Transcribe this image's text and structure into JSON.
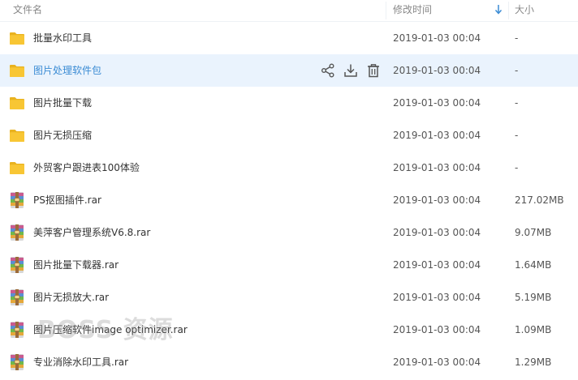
{
  "header": {
    "name": "文件名",
    "time": "修改时间",
    "size": "大小"
  },
  "files": [
    {
      "type": "folder",
      "name": "批量水印工具",
      "time": "2019-01-03 00:04",
      "size": "-"
    },
    {
      "type": "folder",
      "name": "图片处理软件包",
      "time": "2019-01-03 00:04",
      "size": "-",
      "selected": true
    },
    {
      "type": "folder",
      "name": "图片批量下载",
      "time": "2019-01-03 00:04",
      "size": "-"
    },
    {
      "type": "folder",
      "name": "图片无损压缩",
      "time": "2019-01-03 00:04",
      "size": "-"
    },
    {
      "type": "folder",
      "name": "外贸客户跟进表100体验",
      "time": "2019-01-03 00:04",
      "size": "-"
    },
    {
      "type": "rar",
      "name": "PS抠图插件.rar",
      "time": "2019-01-03 00:04",
      "size": "217.02MB"
    },
    {
      "type": "rar",
      "name": "美萍客户管理系统V6.8.rar",
      "time": "2019-01-03 00:04",
      "size": "9.07MB"
    },
    {
      "type": "rar",
      "name": "图片批量下载器.rar",
      "time": "2019-01-03 00:04",
      "size": "1.64MB"
    },
    {
      "type": "rar",
      "name": "图片无损放大.rar",
      "time": "2019-01-03 00:04",
      "size": "5.19MB"
    },
    {
      "type": "rar",
      "name": "图片压缩软件image optimizer.rar",
      "time": "2019-01-03 00:04",
      "size": "1.09MB"
    },
    {
      "type": "rar",
      "name": "专业消除水印工具.rar",
      "time": "2019-01-03 00:04",
      "size": "1.29MB"
    }
  ],
  "watermark": "BOSS 资源",
  "icons": {
    "folder": "folder-icon",
    "rar": "rar-archive-icon",
    "sort": "sort-descending-icon",
    "share": "share-icon",
    "download": "download-icon",
    "delete": "trash-icon"
  },
  "colors": {
    "folder": "#f8c634",
    "selected_row": "#eaf3fd",
    "selected_text": "#3a8bd4",
    "sort_arrow": "#3a8bd4"
  }
}
